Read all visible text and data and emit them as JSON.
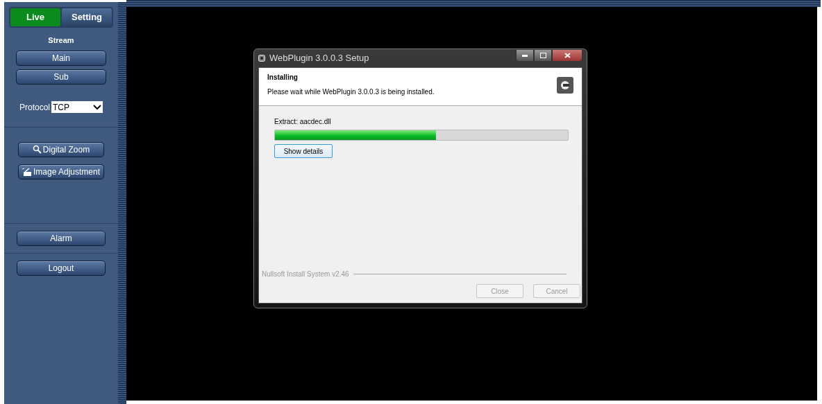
{
  "sidebar": {
    "tabs": [
      {
        "label": "Live",
        "selected": true
      },
      {
        "label": "Setting",
        "selected": false
      }
    ],
    "stream_label": "Stream",
    "stream_buttons": [
      "Main",
      "Sub"
    ],
    "protocol": {
      "label": "Protocol",
      "value": "TCP"
    },
    "tool_buttons": [
      {
        "label": "Digital Zoom",
        "kind": "zoom"
      },
      {
        "label": "Image Adjustment",
        "kind": "image"
      }
    ],
    "alarm_button": "Alarm",
    "logout_button": "Logout"
  },
  "setup_dialog": {
    "title": "WebPlugin 3.0.0.3 Setup",
    "heading": "Installing",
    "subheading": "Please wait while WebPlugin 3.0.0.3 is being installed.",
    "status": "Extract: aacdec.dll",
    "progress": {
      "level": 0.55
    },
    "details_button": "Show details",
    "branding": "Nullsoft Install System v2.46",
    "buttons": [
      {
        "label": "Close",
        "disabled": true
      },
      {
        "label": "Cancel",
        "disabled": true
      }
    ]
  }
}
